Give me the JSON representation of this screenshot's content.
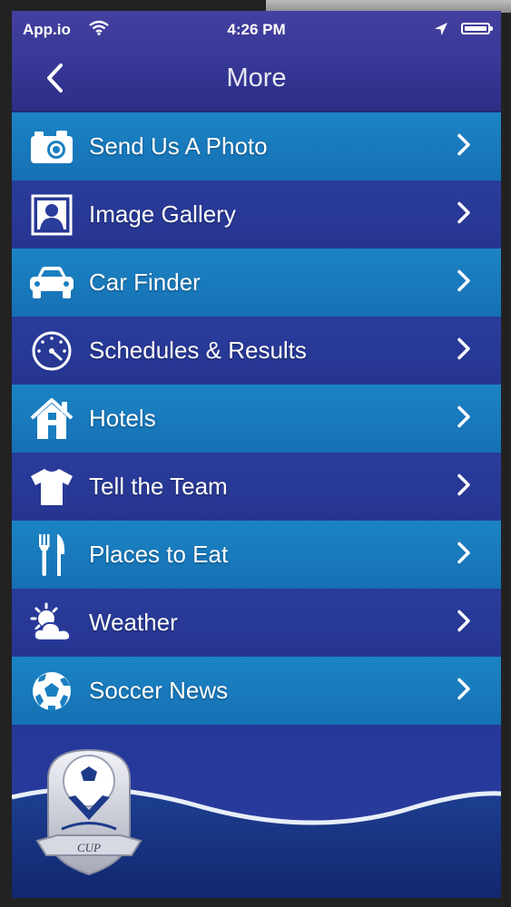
{
  "status_bar": {
    "carrier": "App.io",
    "time": "4:26 PM"
  },
  "nav": {
    "title": "More"
  },
  "menu": {
    "items": [
      {
        "label": "Send Us A Photo",
        "icon": "camera-icon"
      },
      {
        "label": "Image Gallery",
        "icon": "image-gallery-icon"
      },
      {
        "label": "Car Finder",
        "icon": "car-icon"
      },
      {
        "label": "Schedules & Results",
        "icon": "gauge-icon"
      },
      {
        "label": "Hotels",
        "icon": "house-icon"
      },
      {
        "label": "Tell the Team",
        "icon": "tshirt-icon"
      },
      {
        "label": "Places to Eat",
        "icon": "fork-knife-icon"
      },
      {
        "label": "Weather",
        "icon": "weather-icon"
      },
      {
        "label": "Soccer News",
        "icon": "soccer-ball-icon"
      }
    ]
  },
  "colors": {
    "row_light": "#1b84c4",
    "row_dark": "#2a3c9c",
    "nav_bg": "#3c3c9c",
    "text": "#ffffff"
  },
  "logo": {
    "icon": "cup-logo-icon",
    "text": "CUP"
  }
}
